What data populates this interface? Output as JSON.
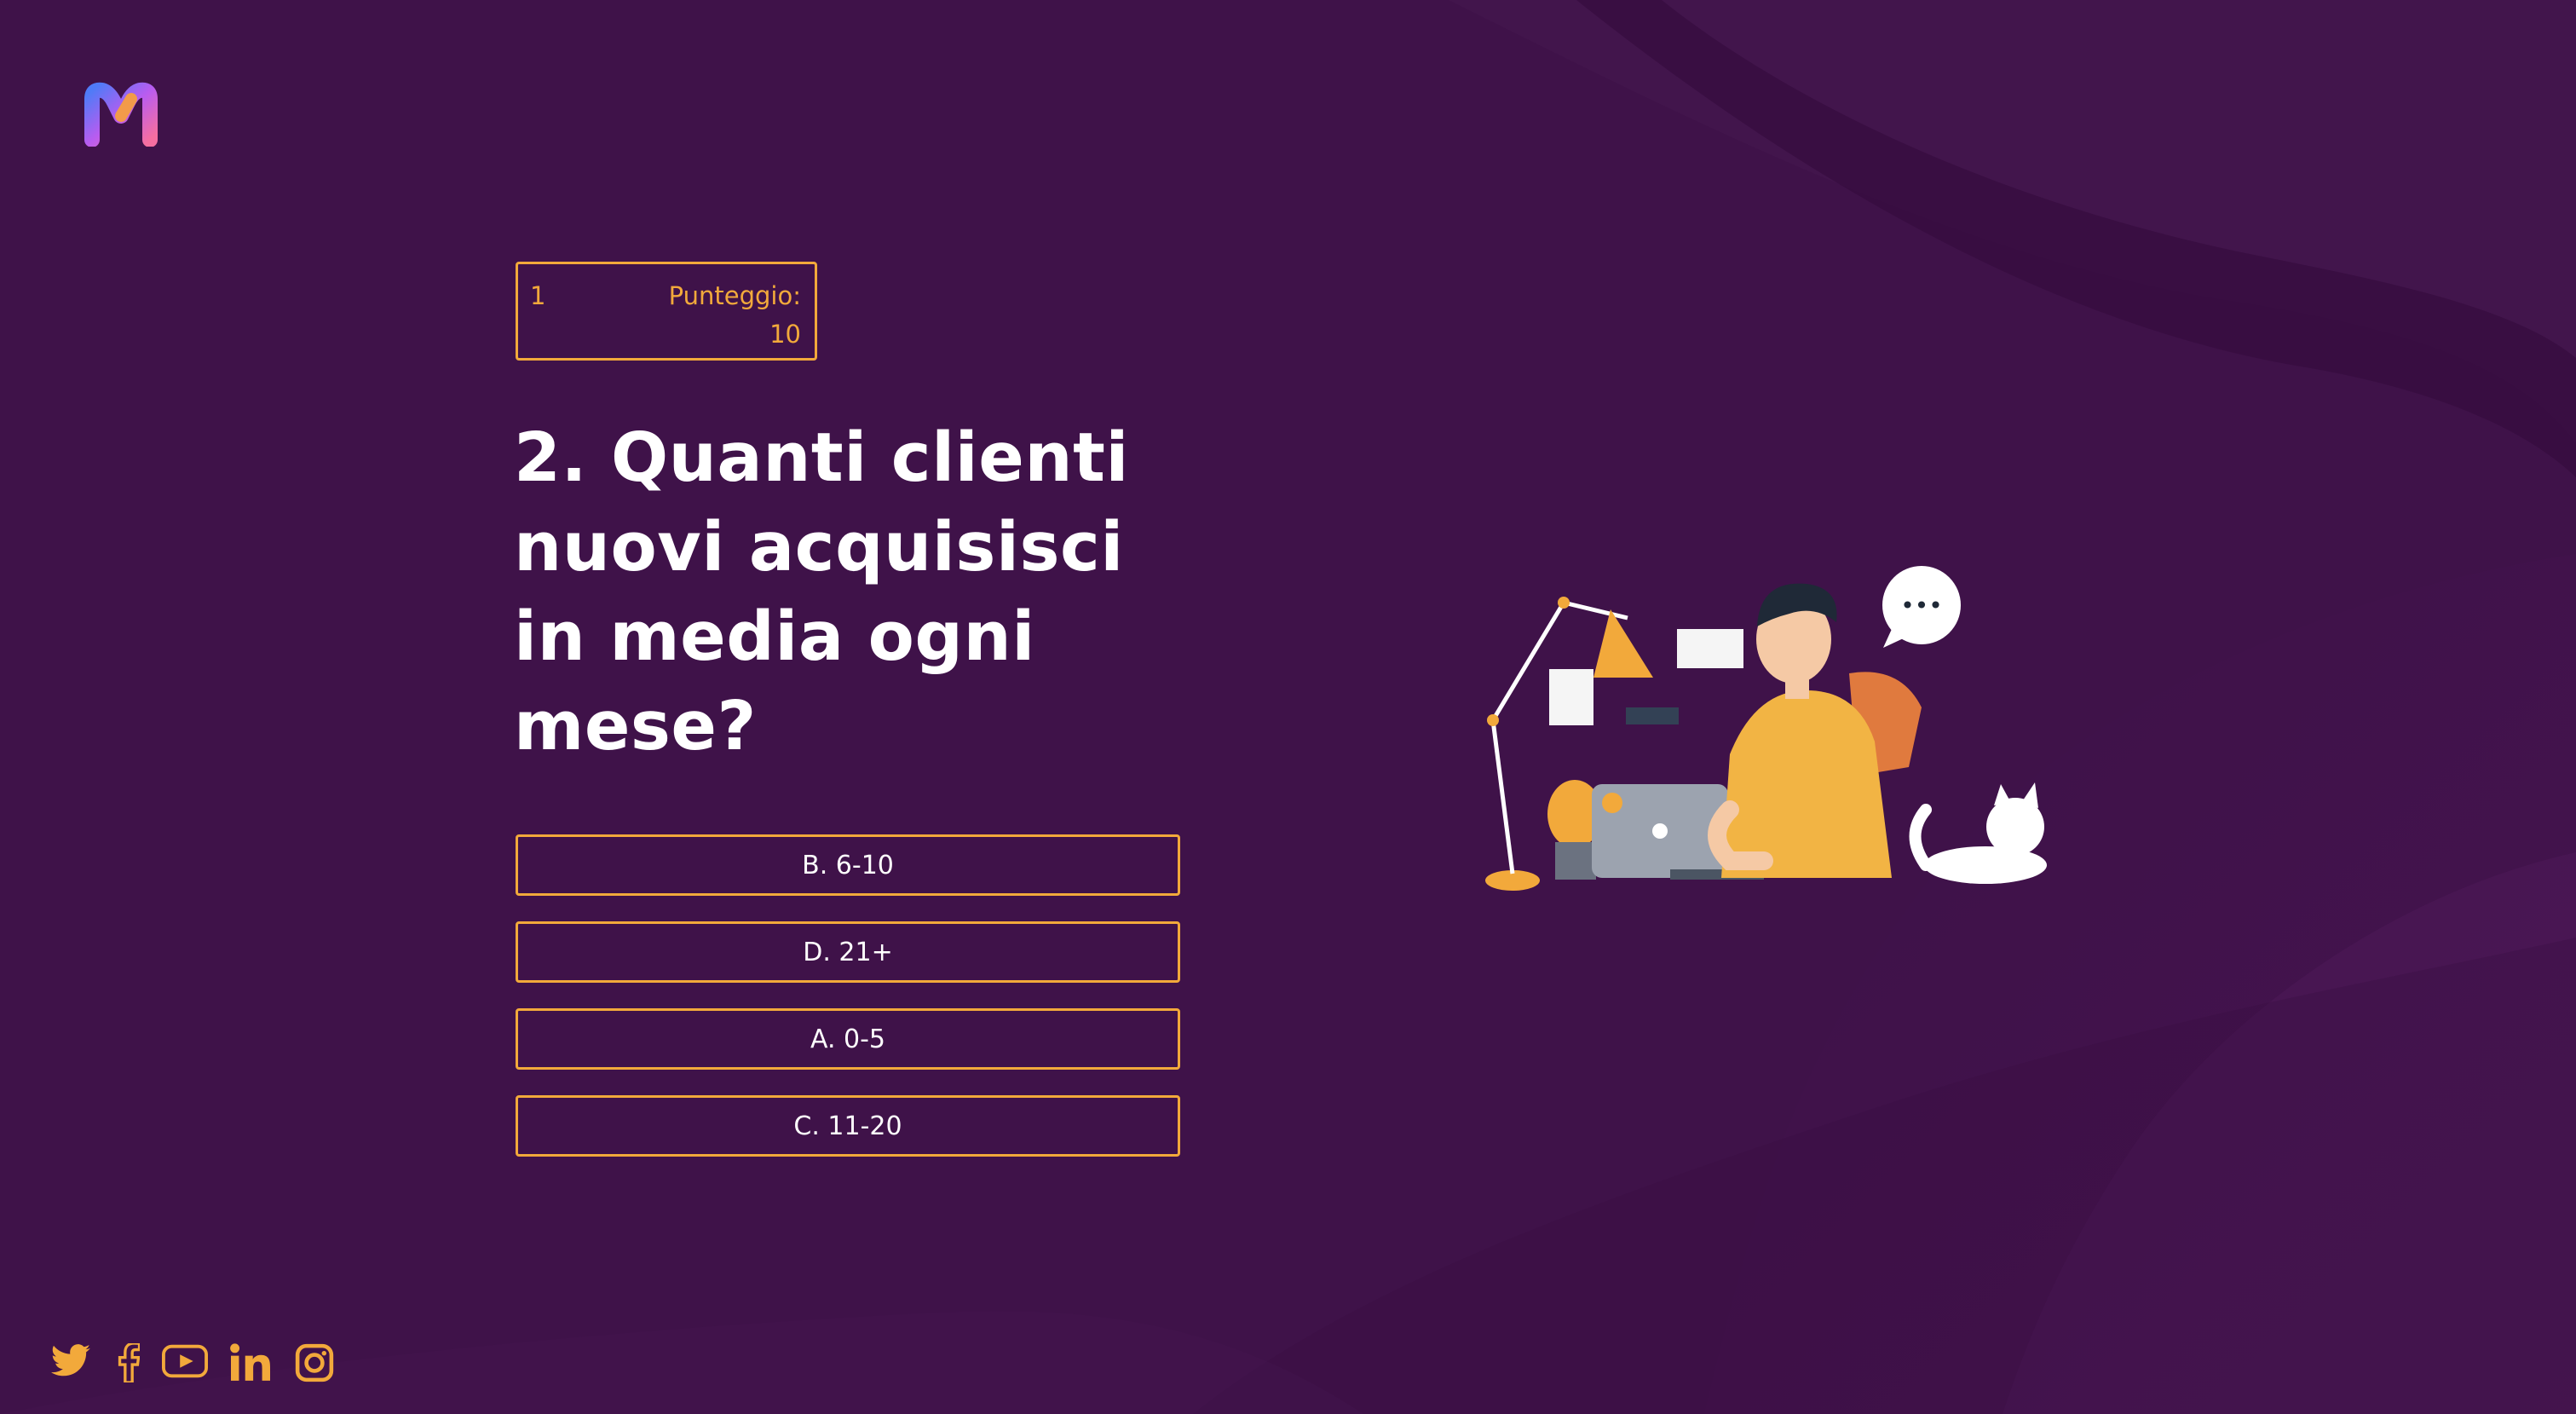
{
  "brand": {
    "logo_letter": "M"
  },
  "score": {
    "question_number": "1",
    "label": "Punteggio:",
    "value": "10"
  },
  "question": {
    "line1": "2. Quanti clienti",
    "line2": "nuovi acquisisci",
    "line3": "in media ogni",
    "line4": "mese?"
  },
  "answers": [
    {
      "label": "B. 6-10"
    },
    {
      "label": "D. 21+"
    },
    {
      "label": "A. 0-5"
    },
    {
      "label": "C. 11-20"
    }
  ],
  "speech_bubble": {
    "text": "•••"
  },
  "social": [
    {
      "icon": "twitter-icon"
    },
    {
      "icon": "facebook-icon"
    },
    {
      "icon": "youtube-icon"
    },
    {
      "icon": "linkedin-icon"
    },
    {
      "icon": "instagram-icon"
    }
  ],
  "colors": {
    "background": "#3f1249",
    "accent": "#f2a93b",
    "text": "#ffffff"
  }
}
